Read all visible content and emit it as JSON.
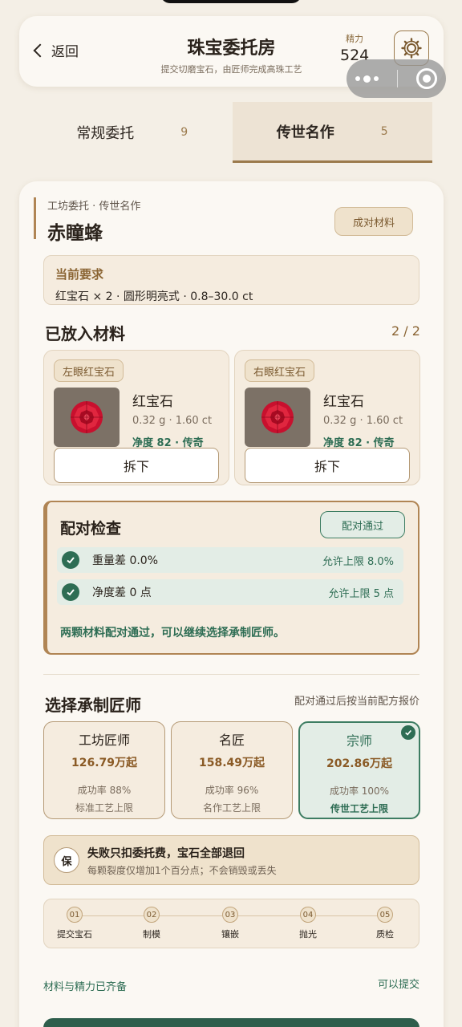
{
  "header": {
    "back_label": "返回",
    "title": "珠宝委托房",
    "subtitle": "提交切磨宝石，由匠师完成高珠工艺",
    "energy_label": "精力",
    "energy_value": "524"
  },
  "tabs": [
    {
      "label": "常规委托",
      "count": "9",
      "active": false
    },
    {
      "label": "传世名作",
      "count": "5",
      "active": true
    }
  ],
  "commission": {
    "breadcrumb": "工坊委托 · 传世名作",
    "name": "赤瞳蜂",
    "tag": "成对材料",
    "requirement_label": "当前要求",
    "requirement_value": "红宝石 × 2 · 圆形明亮式 · 0.8–30.0 ct"
  },
  "materials": {
    "title": "已放入材料",
    "count": "2 / 2",
    "items": [
      {
        "slot": "左眼红宝石",
        "name": "红宝石",
        "spec": "0.32 g · 1.60 ct",
        "grade": "净度 82 · 传奇",
        "remove_label": "拆下"
      },
      {
        "slot": "右眼红宝石",
        "name": "红宝石",
        "spec": "0.32 g · 1.60 ct",
        "grade": "净度 82 · 传奇",
        "remove_label": "拆下"
      }
    ]
  },
  "pair_check": {
    "title": "配对检查",
    "status": "配对通过",
    "rows": [
      {
        "label": "重量差 0.0%",
        "limit": "允许上限 8.0%"
      },
      {
        "label": "净度差 0 点",
        "limit": "允许上限 5 点"
      }
    ],
    "note": "两颗材料配对通过，可以继续选择承制匠师。"
  },
  "crafters": {
    "title": "选择承制匠师",
    "hint": "配对通过后按当前配方报价",
    "items": [
      {
        "name": "工坊匠师",
        "price": "126.79万起",
        "rate": "成功率 88%",
        "limit": "标准工艺上限",
        "selected": false
      },
      {
        "name": "名匠",
        "price": "158.49万起",
        "rate": "成功率 96%",
        "limit": "名作工艺上限",
        "selected": false
      },
      {
        "name": "宗师",
        "price": "202.86万起",
        "rate": "成功率 100%",
        "limit": "传世工艺上限",
        "selected": true
      }
    ]
  },
  "guarantee": {
    "seal": "保",
    "title": "失败只扣委托费，宝石全部退回",
    "desc": "每颗裂度仅增加1个百分点；不会销毁或丢失"
  },
  "steps": [
    {
      "num": "01",
      "label": "提交宝石"
    },
    {
      "num": "02",
      "label": "制模"
    },
    {
      "num": "03",
      "label": "镶嵌"
    },
    {
      "num": "04",
      "label": "抛光"
    },
    {
      "num": "05",
      "label": "质检"
    }
  ],
  "footer": {
    "ready_text": "材料与精力已齐备",
    "submit_hint": "可以提交"
  },
  "colors": {
    "accent_gold": "#9b7a4c",
    "success_green": "#2e6d54",
    "ruby": "#c8102e",
    "background": "#f4efe6"
  }
}
